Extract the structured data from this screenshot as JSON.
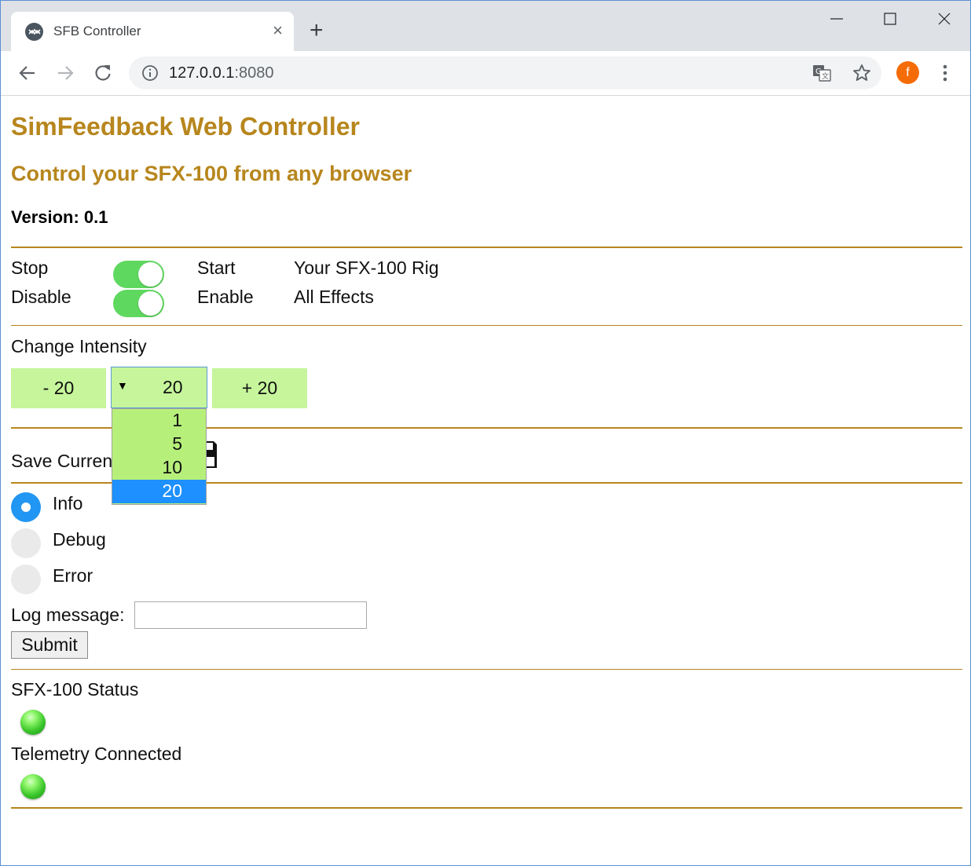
{
  "browser": {
    "tab_title": "SFB Controller",
    "tab_close": "×",
    "new_tab": "+",
    "url_host": "127.0.0.1",
    "url_port": ":8080",
    "avatar_letter": "f"
  },
  "header": {
    "title": "SimFeedback Web Controller",
    "subtitle": "Control your SFX-100 from any browser",
    "version": "Version: 0.1"
  },
  "toggles": [
    {
      "off_label": "Stop",
      "on_label": "Start",
      "target": "Your SFX-100 Rig",
      "on": true
    },
    {
      "off_label": "Disable",
      "on_label": "Enable",
      "target": "All Effects",
      "on": true
    }
  ],
  "intensity": {
    "heading": "Change Intensity",
    "minus_label": "- 20",
    "plus_label": "+ 20",
    "select_value": "20",
    "select_arrow": "▼",
    "options": [
      "1",
      "5",
      "10",
      "20"
    ],
    "selected_option": "20"
  },
  "save": {
    "label": "Save Curren"
  },
  "log_levels": {
    "options": [
      "Info",
      "Debug",
      "Error"
    ],
    "selected": "Info"
  },
  "log_form": {
    "label": "Log message:",
    "value": "",
    "submit_label": "Submit"
  },
  "status": {
    "sfx_label": "SFX-100 Status",
    "telemetry_label": "Telemetry Connected"
  },
  "colors": {
    "accent": "#b7861d",
    "toggle_on": "#5fd85f",
    "button_green": "#c6f59b",
    "dropdown_bg": "#b7ef7b",
    "dropdown_selected": "#1e90ff",
    "radio_selected": "#2196f3",
    "avatar": "#f56c06"
  }
}
